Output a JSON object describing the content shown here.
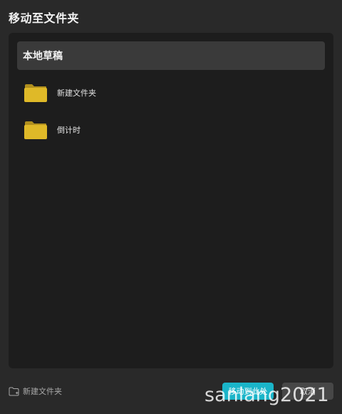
{
  "dialog": {
    "title": "移动至文件夹"
  },
  "tree": {
    "root_label": "本地草稿",
    "folders": [
      {
        "label": "新建文件夹",
        "icon": "folder-icon"
      },
      {
        "label": "倒计时",
        "icon": "folder-icon"
      }
    ]
  },
  "footer": {
    "new_folder_label": "新建文件夹",
    "move_here_label": "移动到此处",
    "cancel_label": "取消"
  },
  "watermark": "sanlang2021",
  "colors": {
    "dialog_bg": "#292929",
    "panel_bg": "#1d1d1d",
    "selected_row_bg": "#3a3a3a",
    "folder_yellow": "#dfb928",
    "folder_tab": "#b08f1e",
    "primary_button": "#1ab5c9",
    "secondary_button": "#474747"
  }
}
